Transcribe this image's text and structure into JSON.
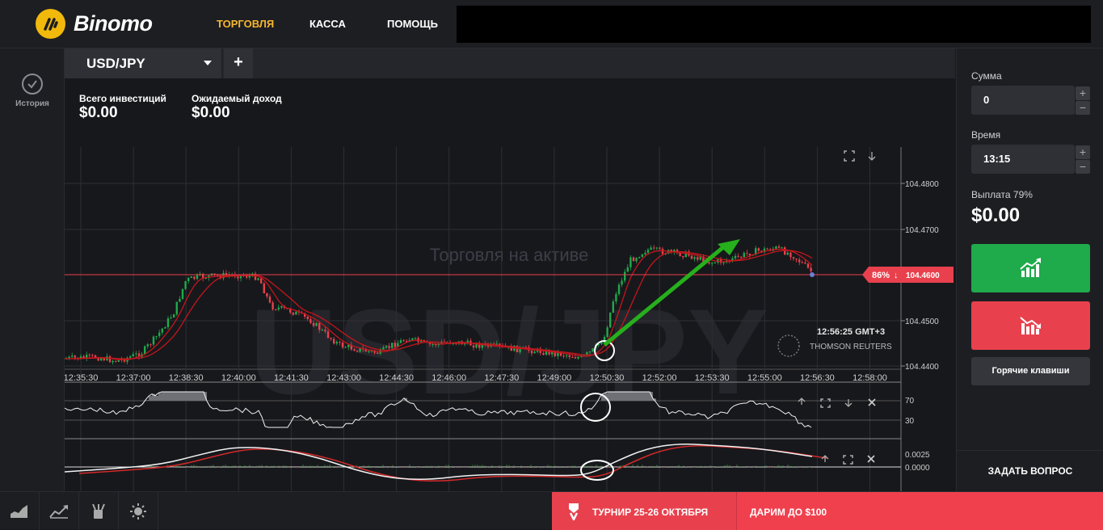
{
  "app": {
    "logo_text": "Binomo",
    "brand_color": "#f0b90b"
  },
  "nav": {
    "trade": "ТОРГОВЛЯ",
    "cash": "КАССА",
    "help": "ПОМОЩЬ"
  },
  "sidebar": {
    "history_label": "История"
  },
  "tab": {
    "asset": "USD/JPY",
    "add_label": "+"
  },
  "investments": {
    "total_label": "Всего инвестиций",
    "total_value": "$0.00",
    "expected_label": "Ожидаемый доход",
    "expected_value": "$0.00"
  },
  "chart": {
    "watermark_asset": "USD/JPY",
    "watermark_caption": "Торговля на активе",
    "server_time": "12:56:25 GMT+3",
    "provider": "THOMSON REUTERS",
    "price_badge_percent": "86%",
    "price_badge_arrow": "↓",
    "current_price": "104.4600",
    "y_ticks": [
      "104.4800",
      "104.4700",
      "104.4500",
      "104.4400"
    ],
    "x_ticks": [
      "12:35:30",
      "12:37:00",
      "12:38:30",
      "12:40:00",
      "12:41:30",
      "12:43:00",
      "12:44:30",
      "12:46:00",
      "12:47:30",
      "12:49:00",
      "12:50:30",
      "12:52:00",
      "12:53:30",
      "12:55:00",
      "12:56:30",
      "12:58:00"
    ],
    "rsi_levels": [
      "70",
      "30"
    ],
    "macd_levels": [
      "0.0025",
      "0.0000"
    ],
    "up_color": "#1faa4b",
    "down_color": "#e8414d"
  },
  "trade": {
    "amount_label": "Сумма",
    "amount_value": "0",
    "time_label": "Время",
    "time_value": "13:15",
    "payout_label": "Выплата 79%",
    "payout_value": "$0.00",
    "plus": "+",
    "minus": "−",
    "hotkeys_label": "Горячие клавиши",
    "ask_label": "ЗАДАТЬ ВОПРОС"
  },
  "promo": {
    "tournament": "ТУРНИР 25-26 ОКТЯБРЯ",
    "gift": "ДАРИМ ДО $100"
  },
  "tools": [
    "chart-type-icon",
    "indicators-icon",
    "drawing-icon",
    "theme-icon"
  ]
}
